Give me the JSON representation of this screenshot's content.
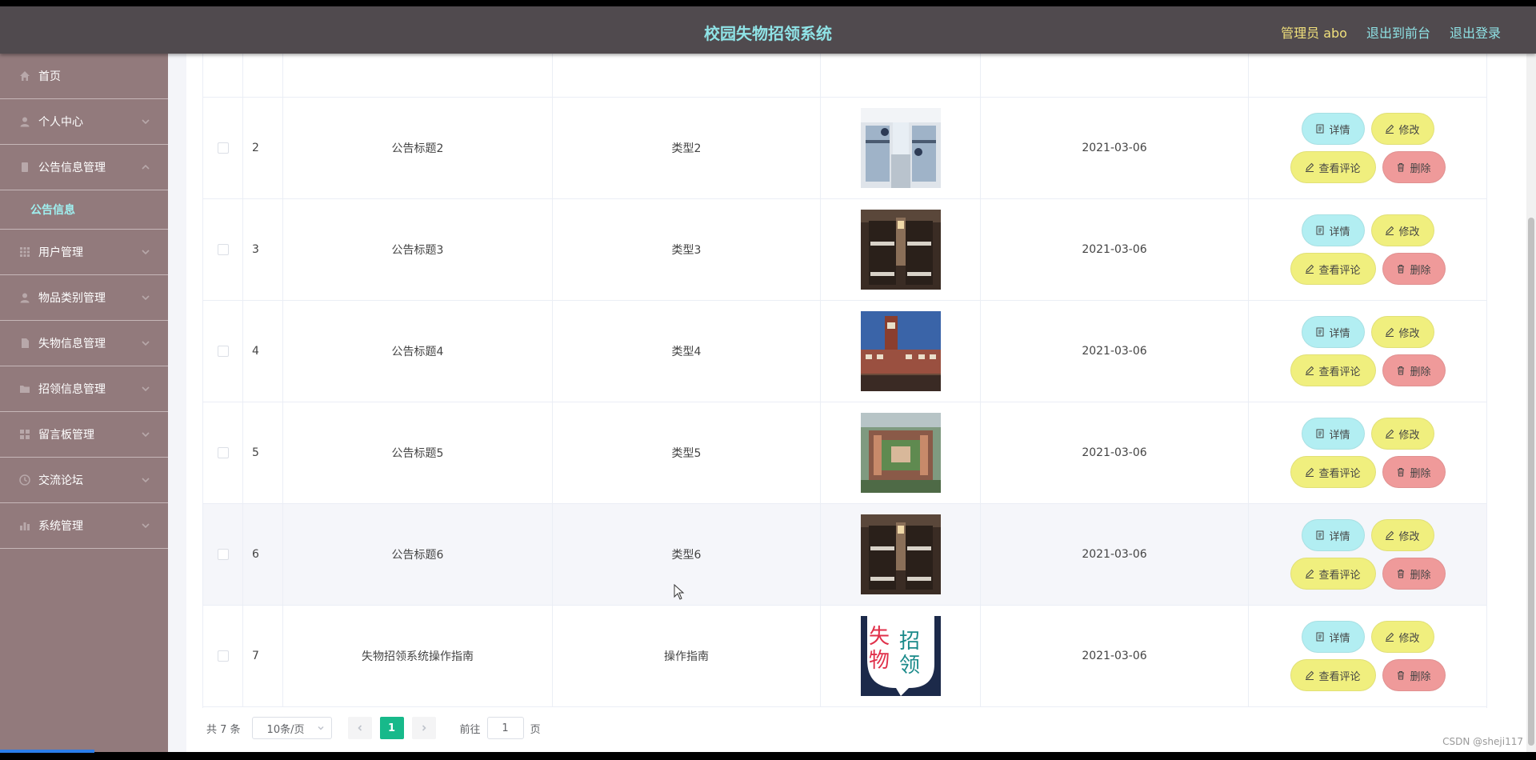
{
  "header": {
    "title": "校园失物招领系统",
    "admin": "管理员 abo",
    "to_front": "退出到前台",
    "logout": "退出登录"
  },
  "sidebar": {
    "items": [
      {
        "label": "首页",
        "icon": "home-icon"
      },
      {
        "label": "个人中心",
        "icon": "user-icon"
      },
      {
        "label": "公告信息管理",
        "icon": "notice-icon"
      },
      {
        "label": "用户管理",
        "icon": "grid-icon"
      },
      {
        "label": "物品类别管理",
        "icon": "user-icon"
      },
      {
        "label": "失物信息管理",
        "icon": "document-icon"
      },
      {
        "label": "招领信息管理",
        "icon": "folder-icon"
      },
      {
        "label": "留言板管理",
        "icon": "grid-icon"
      },
      {
        "label": "交流论坛",
        "icon": "clock-icon"
      },
      {
        "label": "系统管理",
        "icon": "bar-chart-icon"
      }
    ],
    "active_sub": "公告信息"
  },
  "table": {
    "rows": [
      {
        "index": "2",
        "title": "公告标题2",
        "type": "类型2",
        "date": "2021-03-06",
        "image": "dorm-room-photo"
      },
      {
        "index": "3",
        "title": "公告标题3",
        "type": "类型3",
        "date": "2021-03-06",
        "image": "bunk-bed-photo"
      },
      {
        "index": "4",
        "title": "公告标题4",
        "type": "类型4",
        "date": "2021-03-06",
        "image": "campus-building-photo"
      },
      {
        "index": "5",
        "title": "公告标题5",
        "type": "类型5",
        "date": "2021-03-06",
        "image": "campus-aerial-photo"
      },
      {
        "index": "6",
        "title": "公告标题6",
        "type": "类型6",
        "date": "2021-03-06",
        "image": "bunk-bed-photo"
      },
      {
        "index": "7",
        "title": "失物招领系统操作指南",
        "type": "操作指南",
        "date": "2021-03-06",
        "image": "lost-found-logo"
      }
    ],
    "buttons": {
      "detail": "详情",
      "edit": "修改",
      "comment": "查看评论",
      "delete": "删除"
    }
  },
  "logo_text": [
    "失",
    "招",
    "物",
    "领"
  ],
  "pagination": {
    "total": "共 7 条",
    "page_size": "10条/页",
    "current_page": "1",
    "goto_prefix": "前往",
    "goto_value": "1",
    "goto_suffix": "页"
  },
  "watermark": "CSDN @sheji117",
  "colors": {
    "header_bg": "#504a4e",
    "title": "#8fe3e6",
    "sidebar_bg": "#927a7c",
    "detail_btn": "#b2eef2",
    "edit_btn": "#f0ef7e",
    "delete_btn": "#ef9a9a",
    "page_active": "#17b98a"
  }
}
